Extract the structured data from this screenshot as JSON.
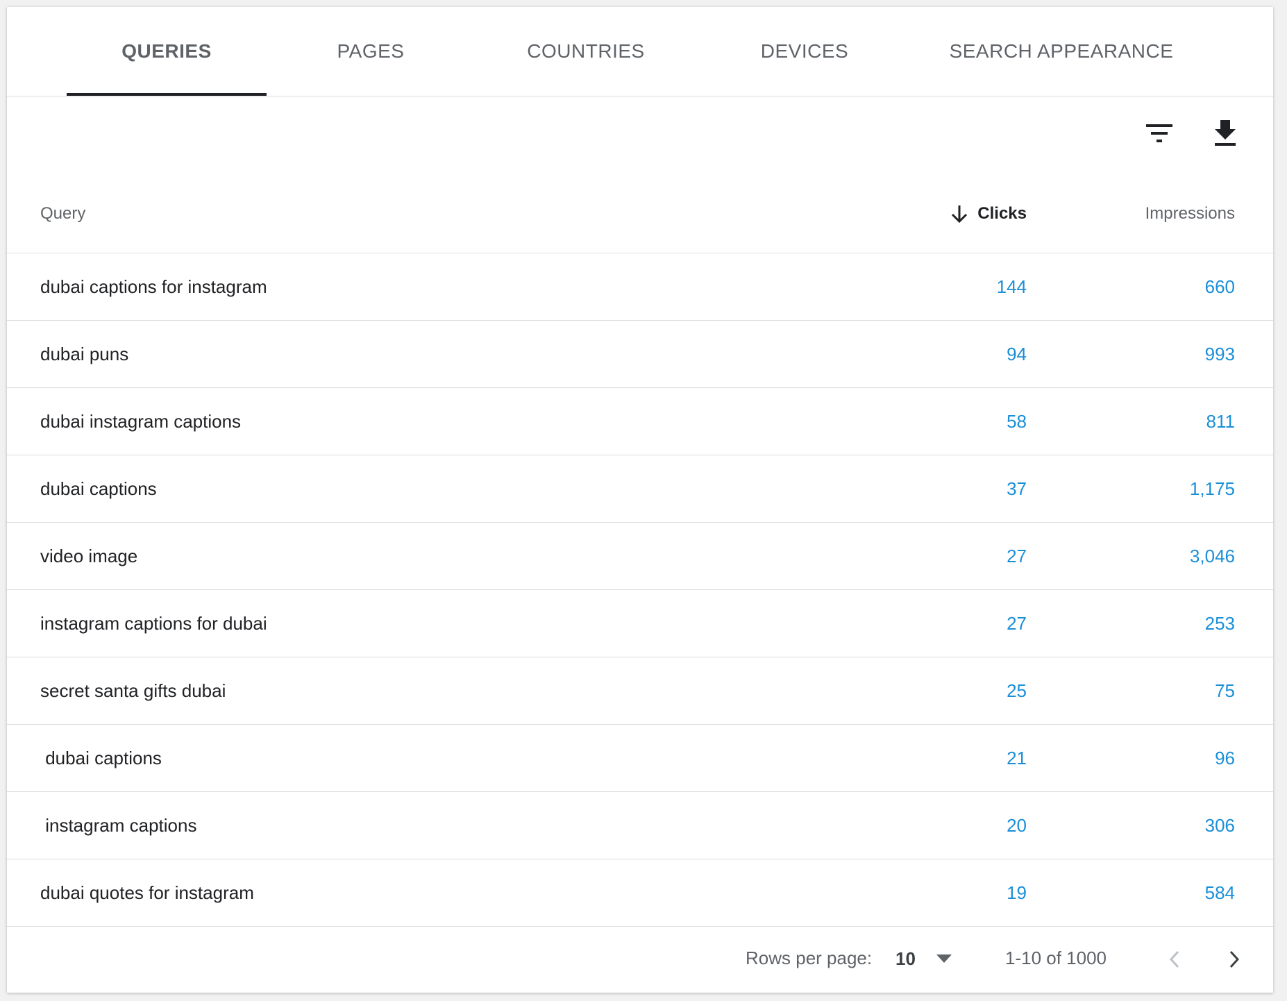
{
  "tabs": [
    {
      "label": "QUERIES",
      "active": true
    },
    {
      "label": "PAGES",
      "active": false
    },
    {
      "label": "COUNTRIES",
      "active": false
    },
    {
      "label": "DEVICES",
      "active": false
    },
    {
      "label": "SEARCH APPEARANCE",
      "active": false
    }
  ],
  "toolbar": {
    "filter_icon": "filter-list-icon",
    "download_icon": "download-icon"
  },
  "table": {
    "headers": {
      "query": "Query",
      "clicks": "Clicks",
      "impressions": "Impressions"
    },
    "sort": {
      "column": "Clicks",
      "direction": "descending",
      "icon": "arrow-down-icon"
    },
    "rows": [
      {
        "query": "dubai captions for instagram",
        "clicks": "144",
        "impressions": "660"
      },
      {
        "query": "dubai puns",
        "clicks": "94",
        "impressions": "993"
      },
      {
        "query": "dubai instagram captions",
        "clicks": "58",
        "impressions": "811"
      },
      {
        "query": "dubai captions",
        "clicks": "37",
        "impressions": "1,175"
      },
      {
        "query": "video image",
        "clicks": "27",
        "impressions": "3,046"
      },
      {
        "query": "instagram captions for dubai",
        "clicks": "27",
        "impressions": "253"
      },
      {
        "query": "secret santa gifts dubai",
        "clicks": "25",
        "impressions": "75"
      },
      {
        "query": " dubai captions",
        "clicks": "21",
        "impressions": "96"
      },
      {
        "query": " instagram captions",
        "clicks": "20",
        "impressions": "306"
      },
      {
        "query": "dubai quotes for instagram",
        "clicks": "19",
        "impressions": "584"
      }
    ]
  },
  "footer": {
    "rows_per_page_label": "Rows per page:",
    "rows_per_page_value": "10",
    "range_text": "1-10 of 1000",
    "prev_icon": "chevron-left-icon",
    "next_icon": "chevron-right-icon"
  },
  "colors": {
    "value_blue": "#1a8fd8",
    "text_dark": "#202124",
    "text_muted": "#5f6368",
    "divider": "#dadce0"
  }
}
